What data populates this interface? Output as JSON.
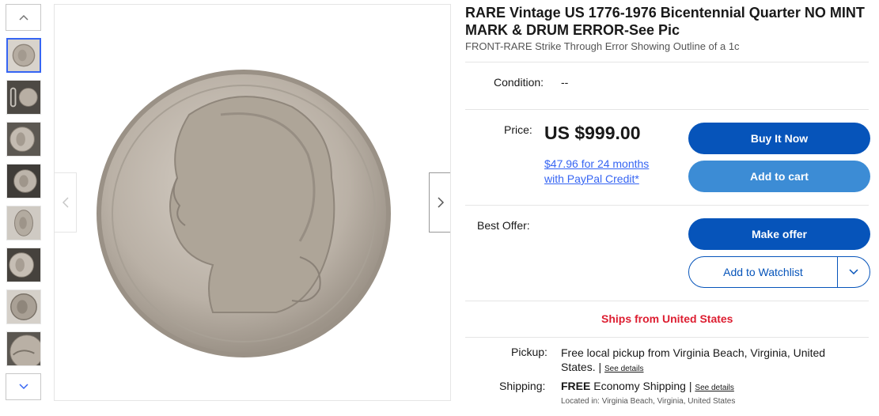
{
  "gallery": {
    "thumbnails": [
      {
        "name": "coin-front",
        "selected": true
      },
      {
        "name": "coin-with-paperclip",
        "selected": false
      },
      {
        "name": "coin-edge-left",
        "selected": false
      },
      {
        "name": "coin-front-angle",
        "selected": false
      },
      {
        "name": "coin-front-tilt",
        "selected": false
      },
      {
        "name": "coin-edge-right",
        "selected": false
      },
      {
        "name": "coin-front-dark",
        "selected": false
      },
      {
        "name": "coin-date-closeup",
        "selected": false
      }
    ],
    "up_icon": "chevron-up-icon",
    "down_icon": "chevron-down-icon",
    "prev_icon": "chevron-left-icon",
    "next_icon": "chevron-right-icon"
  },
  "listing": {
    "title": "RARE Vintage US 1776-1976 Bicentennial Quarter NO MINT MARK & DRUM ERROR-See Pic",
    "subtitle": "FRONT-RARE Strike Through Error Showing Outline of a 1c",
    "condition_label": "Condition:",
    "condition_value": "--",
    "price_label": "Price:",
    "price_value": "US $999.00",
    "paypal_credit": "$47.96 for 24 months with PayPal Credit*",
    "best_offer_label": "Best Offer:",
    "ships_from": "Ships from United States"
  },
  "buttons": {
    "buy_now": "Buy It Now",
    "add_to_cart": "Add to cart",
    "make_offer": "Make offer",
    "watchlist": "Add to Watchlist"
  },
  "shipping": {
    "pickup_label": "Pickup:",
    "pickup_text": "Free local pickup from Virginia Beach, Virginia, United States.",
    "pickup_sep": "|",
    "see_details": "See details",
    "shipping_label": "Shipping:",
    "shipping_free": "FREE",
    "shipping_text": "Economy Shipping",
    "shipping_sep": "|",
    "located": "Located in: Virginia Beach, Virginia, United States"
  },
  "colors": {
    "primary_blue": "#0654ba",
    "secondary_blue": "#3c8cd5",
    "link_blue": "#3665f3",
    "ships_red": "#dd1e31"
  }
}
